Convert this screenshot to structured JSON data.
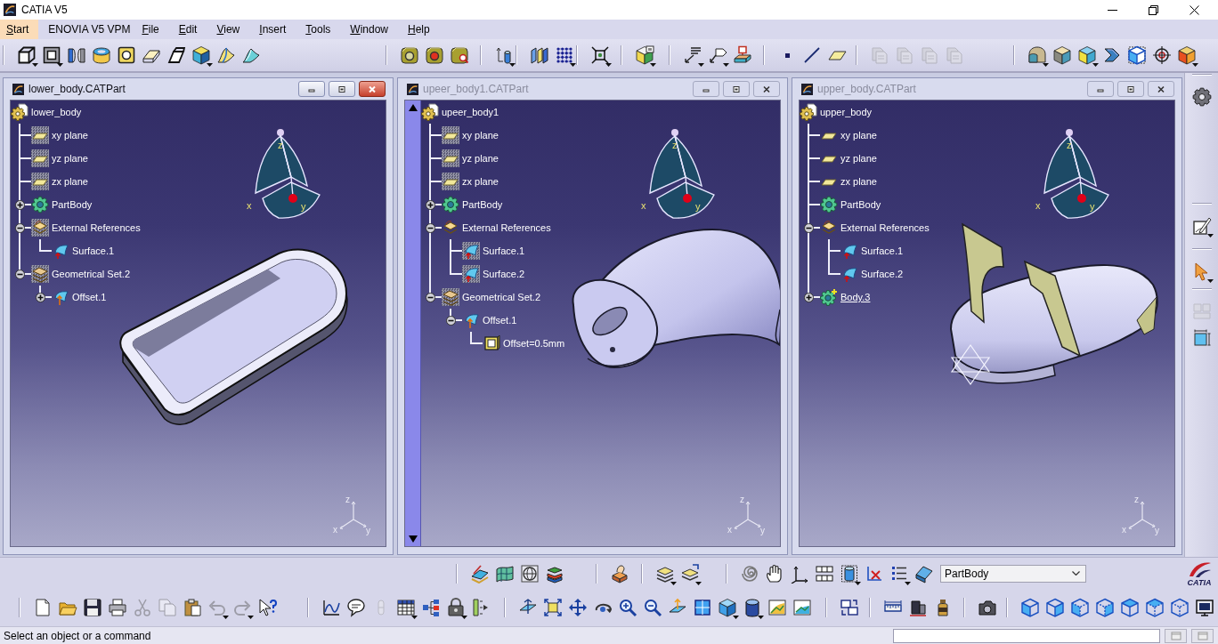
{
  "window": {
    "title": "CATIA V5"
  },
  "menu": [
    {
      "label": "Start",
      "selected": true,
      "mnemonic": true
    },
    {
      "label": "ENOVIA V5 VPM",
      "selected": false,
      "mnemonic": false
    },
    {
      "label": "File",
      "selected": false,
      "mnemonic": true
    },
    {
      "label": "Edit",
      "selected": false,
      "mnemonic": true
    },
    {
      "label": "View",
      "selected": false,
      "mnemonic": true
    },
    {
      "label": "Insert",
      "selected": false,
      "mnemonic": true
    },
    {
      "label": "Tools",
      "selected": false,
      "mnemonic": true
    },
    {
      "label": "Window",
      "selected": false,
      "mnemonic": true
    },
    {
      "label": "Help",
      "selected": false,
      "mnemonic": true
    }
  ],
  "toolbar_top": {
    "groups": [
      [
        {
          "dropdown": true,
          "disabled": false
        },
        {
          "dropdown": true,
          "disabled": false
        },
        {
          "dropdown": false,
          "disabled": false
        },
        {
          "dropdown": false,
          "disabled": false
        },
        {
          "dropdown": false,
          "disabled": false
        },
        {
          "dropdown": false,
          "disabled": false
        },
        {
          "dropdown": false,
          "disabled": false
        },
        {
          "dropdown": true,
          "disabled": false
        },
        {
          "dropdown": false,
          "disabled": false
        },
        {
          "dropdown": false,
          "disabled": false
        }
      ],
      [
        {
          "dropdown": false,
          "disabled": false
        },
        {
          "dropdown": false,
          "disabled": false
        },
        {
          "dropdown": false,
          "disabled": false
        }
      ],
      [
        {
          "dropdown": true,
          "disabled": false
        }
      ],
      [
        {
          "dropdown": false,
          "disabled": false
        },
        {
          "dropdown": true,
          "disabled": false
        }
      ],
      [
        {
          "dropdown": true,
          "disabled": false
        }
      ],
      [
        {
          "dropdown": true,
          "disabled": false
        }
      ],
      [
        {
          "dropdown": true,
          "disabled": false
        },
        {
          "dropdown": true,
          "disabled": false
        },
        {
          "dropdown": false,
          "disabled": false
        }
      ],
      [
        {
          "dropdown": false,
          "disabled": false
        },
        {
          "dropdown": false,
          "disabled": false
        },
        {
          "dropdown": false,
          "disabled": false
        }
      ],
      [
        {
          "dropdown": false,
          "disabled": true
        },
        {
          "dropdown": false,
          "disabled": true
        },
        {
          "dropdown": false,
          "disabled": true
        },
        {
          "dropdown": false,
          "disabled": true
        }
      ],
      [
        {
          "dropdown": true,
          "disabled": false
        },
        {
          "dropdown": false,
          "disabled": false
        },
        {
          "dropdown": true,
          "disabled": false
        },
        {
          "dropdown": false,
          "disabled": false
        },
        {
          "dropdown": false,
          "disabled": false
        },
        {
          "dropdown": false,
          "disabled": false
        },
        {
          "dropdown": true,
          "disabled": false
        }
      ]
    ]
  },
  "documents": [
    {
      "title": "lower_body.CATPart",
      "active": true,
      "scroll_bar": false,
      "tree": {
        "label": "lower_body",
        "kind": "part",
        "hidden": false,
        "in_work": false,
        "children": [
          {
            "label": "xy plane",
            "kind": "plane",
            "hidden": true,
            "in_work": false
          },
          {
            "label": "yz plane",
            "kind": "plane",
            "hidden": true,
            "in_work": false
          },
          {
            "label": "zx plane",
            "kind": "plane",
            "hidden": true,
            "in_work": false
          },
          {
            "label": "PartBody",
            "kind": "body",
            "hidden": false,
            "in_work": false,
            "expanded": false
          },
          {
            "label": "External References",
            "kind": "references",
            "hidden": true,
            "in_work": false,
            "expanded": true,
            "children": [
              {
                "label": "Surface.1",
                "kind": "surface",
                "hidden": false,
                "in_work": false
              }
            ]
          },
          {
            "label": "Geometrical Set.2",
            "kind": "set",
            "hidden": true,
            "in_work": false,
            "expanded": true,
            "children": [
              {
                "label": "Offset.1",
                "kind": "offset",
                "hidden": false,
                "in_work": false,
                "expanded": false
              }
            ]
          }
        ]
      },
      "compass": {
        "labels": [
          "z",
          "x",
          "y"
        ]
      },
      "model": {
        "kind": "shell"
      },
      "axis_triad": {
        "labels": [
          "z",
          "x",
          "y"
        ]
      }
    },
    {
      "title": "upeer_body1.CATPart",
      "active": false,
      "scroll_bar": true,
      "tree": {
        "label": "upeer_body1",
        "kind": "part",
        "hidden": false,
        "in_work": false,
        "children": [
          {
            "label": "xy plane",
            "kind": "plane",
            "hidden": true,
            "in_work": false
          },
          {
            "label": "yz plane",
            "kind": "plane",
            "hidden": true,
            "in_work": false
          },
          {
            "label": "zx plane",
            "kind": "plane",
            "hidden": true,
            "in_work": false
          },
          {
            "label": "PartBody",
            "kind": "body",
            "hidden": false,
            "in_work": false,
            "expanded": false
          },
          {
            "label": "External References",
            "kind": "references",
            "hidden": false,
            "in_work": false,
            "expanded": true,
            "children": [
              {
                "label": "Surface.1",
                "kind": "surface",
                "hidden": true,
                "in_work": false
              },
              {
                "label": "Surface.2",
                "kind": "surface",
                "hidden": true,
                "in_work": false
              }
            ]
          },
          {
            "label": "Geometrical Set.2",
            "kind": "set",
            "hidden": true,
            "in_work": false,
            "expanded": true,
            "children": [
              {
                "label": "Offset.1",
                "kind": "offset",
                "hidden": false,
                "in_work": false,
                "expanded": true,
                "children": [
                  {
                    "label": "Offset=0.5mm",
                    "kind": "parameter",
                    "hidden": false,
                    "in_work": false
                  }
                ]
              }
            ]
          }
        ]
      },
      "compass": {
        "labels": [
          "z",
          "x",
          "y"
        ]
      },
      "model": {
        "kind": "dome"
      },
      "axis_triad": {
        "labels": [
          "z",
          "x",
          "y"
        ]
      }
    },
    {
      "title": "upper_body.CATPart",
      "active": false,
      "scroll_bar": false,
      "tree": {
        "label": "upper_body",
        "kind": "part",
        "hidden": false,
        "in_work": false,
        "children": [
          {
            "label": "xy plane",
            "kind": "plane",
            "hidden": false,
            "in_work": false
          },
          {
            "label": "yz plane",
            "kind": "plane",
            "hidden": false,
            "in_work": false
          },
          {
            "label": "zx plane",
            "kind": "plane",
            "hidden": false,
            "in_work": false
          },
          {
            "label": "PartBody",
            "kind": "body",
            "hidden": false,
            "in_work": false
          },
          {
            "label": "External References",
            "kind": "references",
            "hidden": false,
            "in_work": false,
            "expanded": true,
            "children": [
              {
                "label": "Surface.1",
                "kind": "surface",
                "hidden": false,
                "in_work": false
              },
              {
                "label": "Surface.2",
                "kind": "surface",
                "hidden": false,
                "in_work": false
              }
            ]
          },
          {
            "label": "Body.3",
            "kind": "new_body",
            "hidden": false,
            "in_work": true,
            "expanded": false
          }
        ]
      },
      "compass": {
        "labels": [
          "z",
          "x",
          "y"
        ]
      },
      "model": {
        "kind": "dome_with_surfaces"
      },
      "axis_triad": {
        "labels": [
          "z",
          "x",
          "y"
        ]
      }
    }
  ],
  "toolbar_side": {
    "groups": [
      [
        {
          "dropdown": false,
          "disabled": false
        }
      ],
      [
        {
          "dropdown": true,
          "disabled": false
        }
      ],
      [
        {
          "dropdown": true,
          "disabled": false
        }
      ],
      [
        {
          "dropdown": false,
          "disabled": true
        },
        {
          "dropdown": false,
          "disabled": false
        }
      ]
    ]
  },
  "toolbar_bottom_upper": {
    "groups": [
      [
        {
          "dropdown": false,
          "disabled": false
        },
        {
          "dropdown": false,
          "disabled": false
        },
        {
          "dropdown": false,
          "disabled": false
        },
        {
          "dropdown": false,
          "disabled": false
        }
      ],
      [
        {
          "dropdown": false,
          "disabled": false
        }
      ],
      [
        {
          "dropdown": true,
          "disabled": false
        },
        {
          "dropdown": true,
          "disabled": false
        }
      ],
      [
        {
          "dropdown": false,
          "disabled": false
        },
        {
          "dropdown": false,
          "disabled": false
        },
        {
          "dropdown": false,
          "disabled": false
        },
        {
          "dropdown": false,
          "disabled": false
        },
        {
          "dropdown": true,
          "disabled": false
        },
        {
          "dropdown": false,
          "disabled": false
        },
        {
          "dropdown": true,
          "disabled": false
        },
        {
          "dropdown": false,
          "disabled": false
        }
      ]
    ]
  },
  "part_selector": {
    "value": "PartBody"
  },
  "logo": {
    "text": "CATIA"
  },
  "toolbar_bottom_lower": {
    "groups": [
      [
        {
          "dropdown": false,
          "disabled": false
        },
        {
          "dropdown": false,
          "disabled": false
        },
        {
          "dropdown": false,
          "disabled": false
        },
        {
          "dropdown": false,
          "disabled": false
        },
        {
          "dropdown": false,
          "disabled": true
        },
        {
          "dropdown": false,
          "disabled": true
        },
        {
          "dropdown": false,
          "disabled": false
        },
        {
          "dropdown": true,
          "disabled": true
        },
        {
          "dropdown": true,
          "disabled": true
        },
        {
          "dropdown": false,
          "disabled": false
        }
      ],
      [
        {
          "dropdown": false,
          "disabled": false
        },
        {
          "dropdown": false,
          "disabled": false
        },
        {
          "dropdown": false,
          "disabled": true
        },
        {
          "dropdown": true,
          "disabled": false
        },
        {
          "dropdown": false,
          "disabled": false
        },
        {
          "dropdown": true,
          "disabled": false
        },
        {
          "dropdown": false,
          "disabled": false
        }
      ],
      [
        {
          "dropdown": false,
          "disabled": false
        },
        {
          "dropdown": false,
          "disabled": false
        },
        {
          "dropdown": false,
          "disabled": false
        },
        {
          "dropdown": false,
          "disabled": false
        },
        {
          "dropdown": false,
          "disabled": false
        },
        {
          "dropdown": false,
          "disabled": false
        },
        {
          "dropdown": false,
          "disabled": false
        },
        {
          "dropdown": false,
          "disabled": false
        },
        {
          "dropdown": true,
          "disabled": false
        },
        {
          "dropdown": true,
          "disabled": false
        },
        {
          "dropdown": false,
          "disabled": false
        },
        {
          "dropdown": false,
          "disabled": false
        }
      ],
      [
        {
          "dropdown": false,
          "disabled": false
        }
      ],
      [
        {
          "dropdown": false,
          "disabled": false
        },
        {
          "dropdown": false,
          "disabled": false
        },
        {
          "dropdown": false,
          "disabled": false
        }
      ],
      [
        {
          "dropdown": false,
          "disabled": false
        }
      ],
      [
        {
          "dropdown": false,
          "disabled": false
        },
        {
          "dropdown": false,
          "disabled": false
        },
        {
          "dropdown": false,
          "disabled": false
        },
        {
          "dropdown": false,
          "disabled": false
        },
        {
          "dropdown": false,
          "disabled": false
        },
        {
          "dropdown": false,
          "disabled": false
        },
        {
          "dropdown": false,
          "disabled": false
        },
        {
          "dropdown": false,
          "disabled": false
        }
      ]
    ]
  },
  "status_bar": {
    "prompt": "Select an object or a command"
  }
}
